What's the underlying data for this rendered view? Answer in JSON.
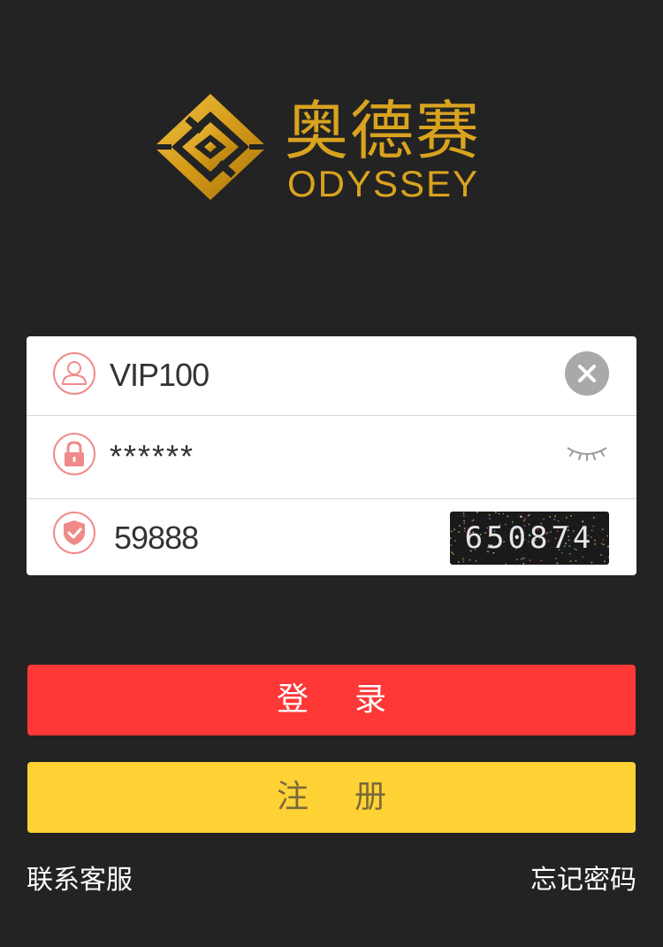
{
  "brand": {
    "name_cn": "奥德赛",
    "name_en": "ODYSSEY",
    "logo_icon": "odyssey-logo-icon",
    "color": "#d9a31f"
  },
  "form": {
    "username": {
      "icon": "user-icon",
      "value": "VIP100",
      "clear_icon": "close-icon"
    },
    "password": {
      "icon": "lock-icon",
      "value": "******",
      "toggle_icon": "eye-closed-icon"
    },
    "captcha": {
      "icon": "shield-check-icon",
      "value": "59888",
      "image_code": "650874"
    }
  },
  "buttons": {
    "login": "登录",
    "register": "注册"
  },
  "links": {
    "contact": "联系客服",
    "forgot": "忘记密码"
  },
  "colors": {
    "background": "#232323",
    "login": "#fe3737",
    "register": "#fed235",
    "icon_accent": "#f08a8a"
  }
}
